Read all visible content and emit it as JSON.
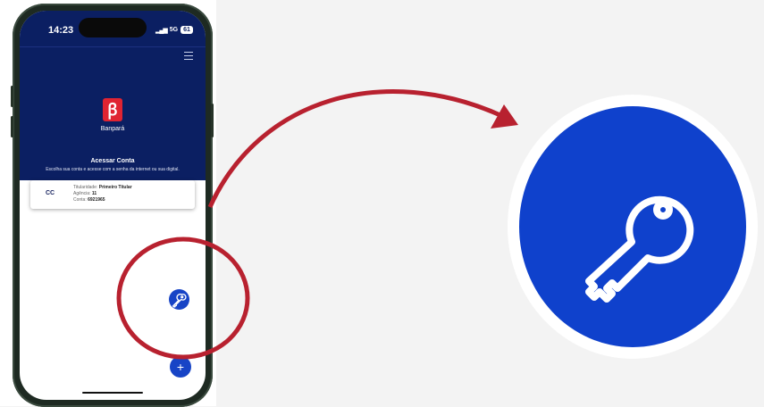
{
  "status_bar": {
    "time": "14:23",
    "network": "5G",
    "battery": "61"
  },
  "app": {
    "brand": "Banpará",
    "title": "Acessar Conta",
    "subtitle": "Escolha sua conta e acesse com a senha da internet ou sua digital."
  },
  "account_card": {
    "type": "CC",
    "holder_label": "Titularidade:",
    "holder_value": "Primeiro Titular",
    "agency_label": "Agência:",
    "agency_value": "11",
    "account_label": "Conta:",
    "account_value": "6921965"
  },
  "icons": {
    "menu": "hamburger-menu-icon",
    "key": "key-icon",
    "add": "plus-icon",
    "logo": "banpara-logo-icon"
  },
  "colors": {
    "header_bg": "#0b1f62",
    "fab": "#1744c6",
    "logo": "#e02432",
    "annotation": "#b8212f",
    "zoom_circle": "#0f41cc"
  }
}
